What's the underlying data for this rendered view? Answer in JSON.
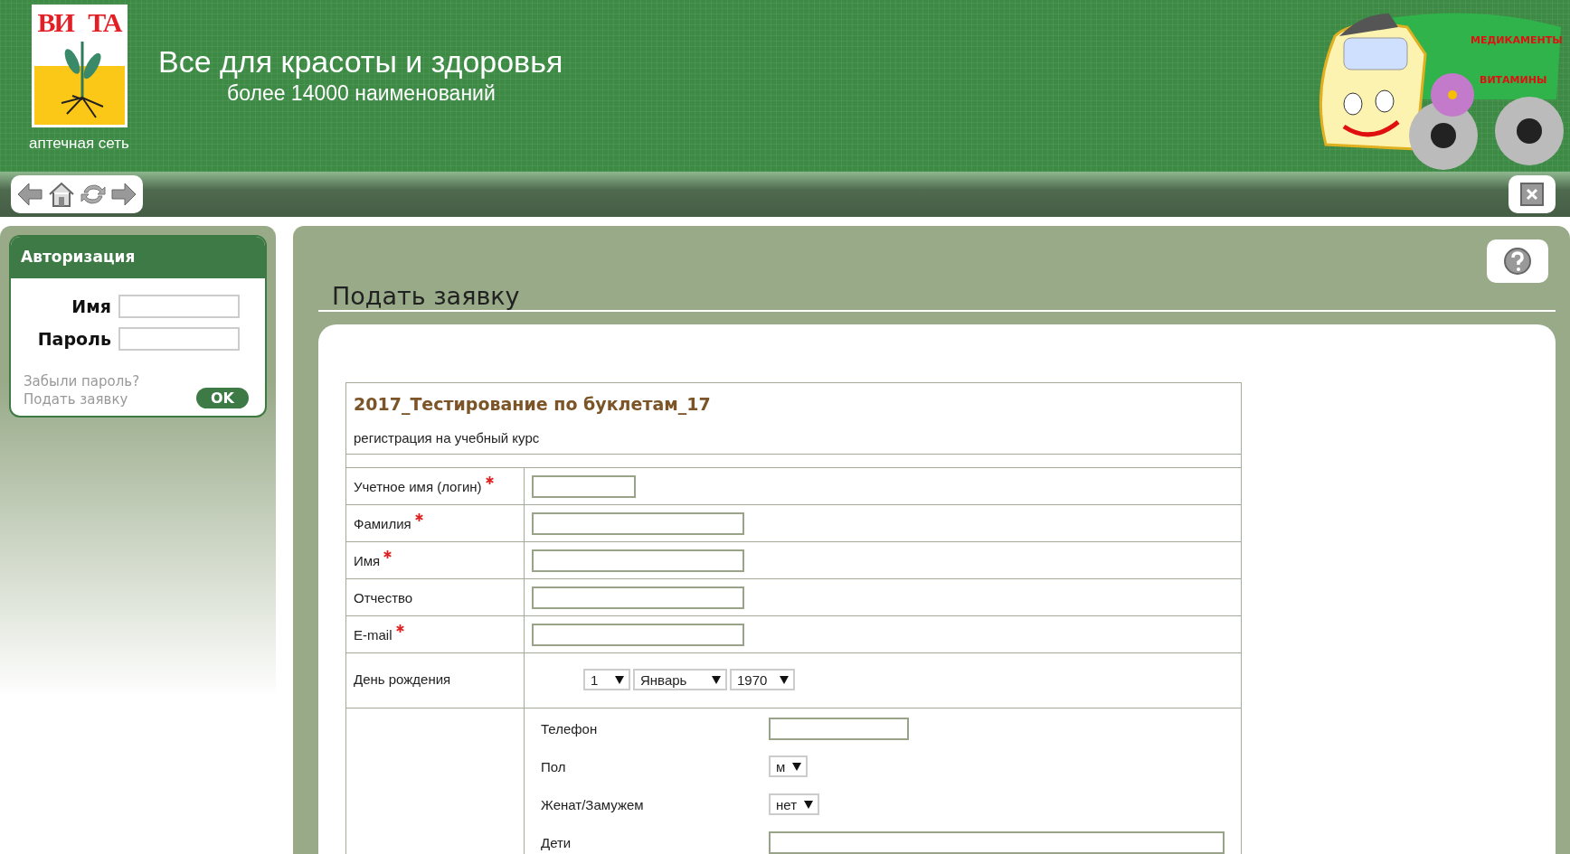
{
  "header": {
    "logo": {
      "letters_left": "ВИ",
      "letters_right": "ТА",
      "caption": "аптечная сеть"
    },
    "title": "Все для красоты и здоровья",
    "subtitle": "более 14000 наименований",
    "truck": {
      "label_top": "МЕДИКАМЕНТЫ",
      "label_bottom": "ВИТАМИНЫ"
    }
  },
  "login": {
    "title": "Авторизация",
    "fields": [
      {
        "label": "Имя"
      },
      {
        "label": "Пароль"
      }
    ],
    "links": [
      "Забыли пароль?",
      "Подать заявку"
    ],
    "button": "OK"
  },
  "page": {
    "title": "Подать заявку"
  },
  "form": {
    "title": "2017_Тестирование по буклетам_17",
    "subtitle": "регистрация на учебный курс",
    "fields": [
      {
        "label": "Учетное имя (логин)",
        "required": true,
        "kind": "short"
      },
      {
        "label": "Фамилия",
        "required": true,
        "kind": "text"
      },
      {
        "label": "Имя",
        "required": true,
        "kind": "text"
      },
      {
        "label": "Отчество",
        "required": false,
        "kind": "text"
      },
      {
        "label": "E-mail",
        "required": true,
        "kind": "text"
      },
      {
        "label": "День рождения",
        "required": false,
        "kind": "date",
        "values": [
          "1",
          "Январь",
          "1970"
        ]
      }
    ],
    "extra_fields": [
      {
        "label": "Телефон",
        "kind": "text"
      },
      {
        "label": "Пол",
        "kind": "select",
        "value": "м"
      },
      {
        "label": "Женат/Замужем",
        "kind": "select",
        "value": "нет"
      },
      {
        "label": "Дети",
        "kind": "wide"
      }
    ]
  }
}
